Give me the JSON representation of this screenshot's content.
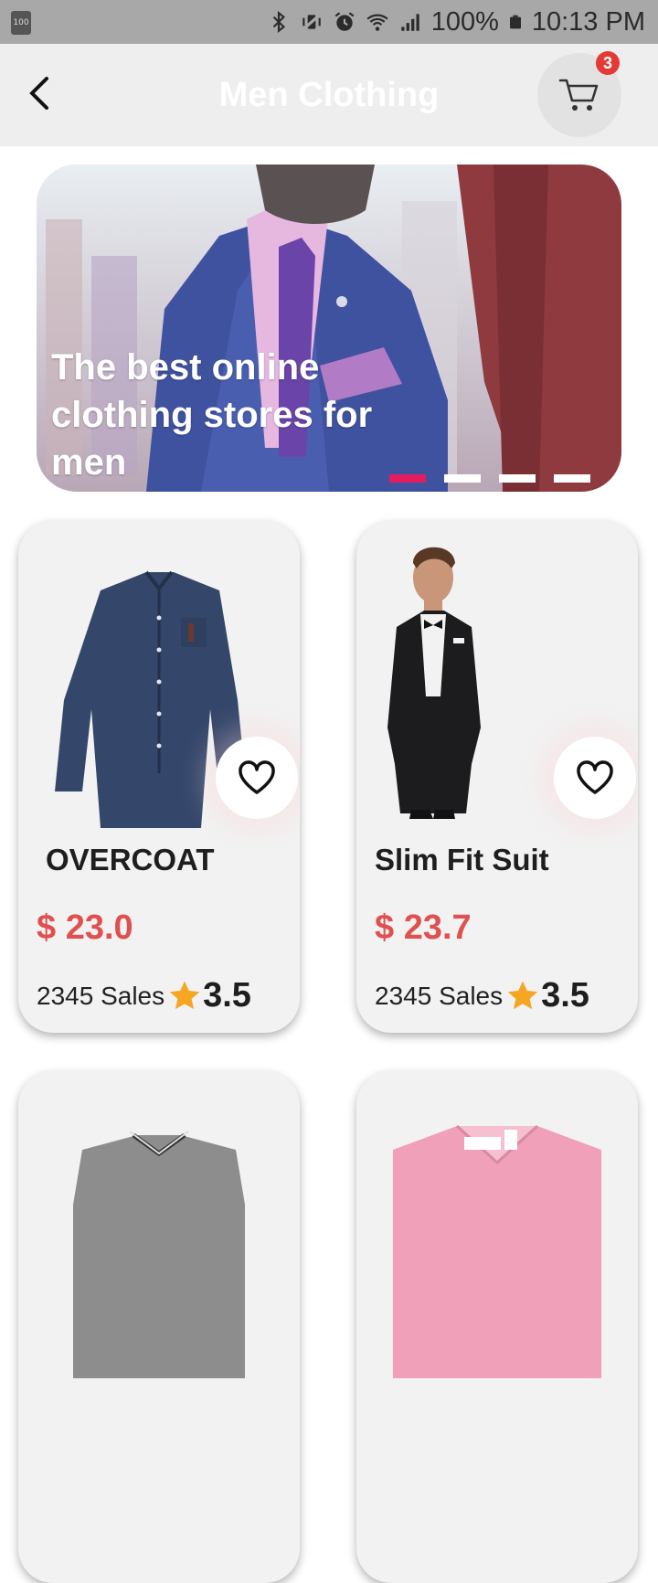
{
  "status_bar": {
    "battery_icon_label": "100",
    "battery": "100%",
    "time": "10:13 PM",
    "icons": [
      "bluetooth-icon",
      "vibrate-icon",
      "alarm-icon",
      "wifi-icon",
      "signal-icon",
      "battery-icon"
    ]
  },
  "app_bar": {
    "title": "Men Clothing",
    "cart_count": "3",
    "back_icon": "chevron-left-icon",
    "cart_icon": "shopping-cart-icon"
  },
  "banner": {
    "text": "The best online clothing stores for men",
    "slides": 4,
    "active_slide": 1
  },
  "products": [
    {
      "name": "OVERCOAT",
      "price": "$ 23.0",
      "sales": "2345 Sales",
      "rating": "3.5",
      "image": "denim-shirt"
    },
    {
      "name": "Slim Fit Suit",
      "price": "$ 23.7",
      "sales": "2345 Sales",
      "rating": "3.5",
      "image": "man-in-black-suit"
    },
    {
      "name": "",
      "price": "",
      "sales": "",
      "rating": "",
      "image": "grey-polo-shirt"
    },
    {
      "name": "",
      "price": "",
      "sales": "",
      "rating": "",
      "image": "pink-dress-shirt"
    }
  ],
  "colors": {
    "accent": "#e31c5f",
    "price": "#e05050",
    "star": "#f5a623",
    "badge": "#e53935"
  }
}
